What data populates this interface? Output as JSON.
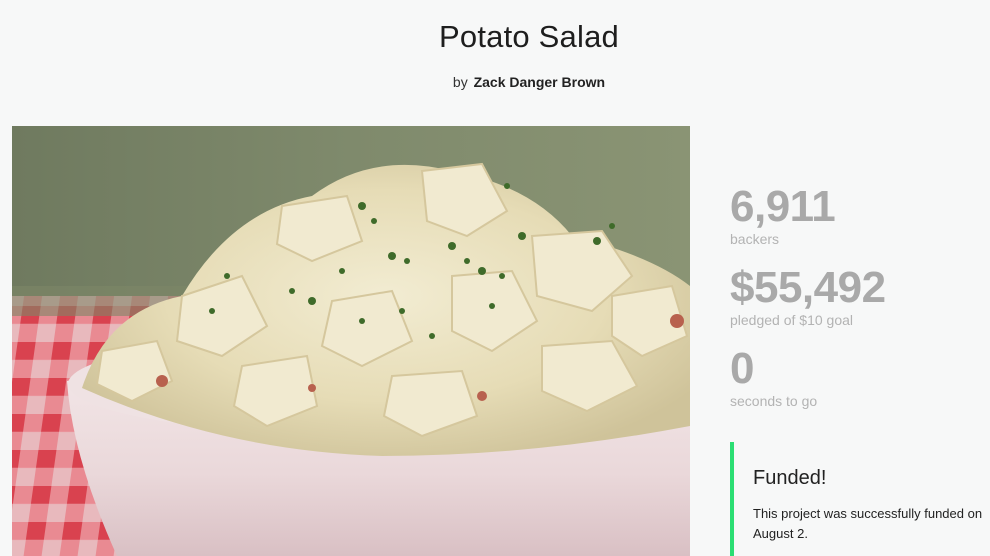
{
  "project": {
    "title": "Potato Salad",
    "by_prefix": "by",
    "creator": "Zack Danger Brown"
  },
  "stats": {
    "backers_count": "6,911",
    "backers_label": "backers",
    "pledged_amount": "$55,492",
    "pledged_label": "pledged of $10 goal",
    "time_remaining": "0",
    "time_label": "seconds to go"
  },
  "funded": {
    "title": "Funded!",
    "message": "This project was successfully funded on August 2."
  },
  "colors": {
    "accent_green": "#2bde73",
    "stat_gray": "#a9a9a9"
  }
}
